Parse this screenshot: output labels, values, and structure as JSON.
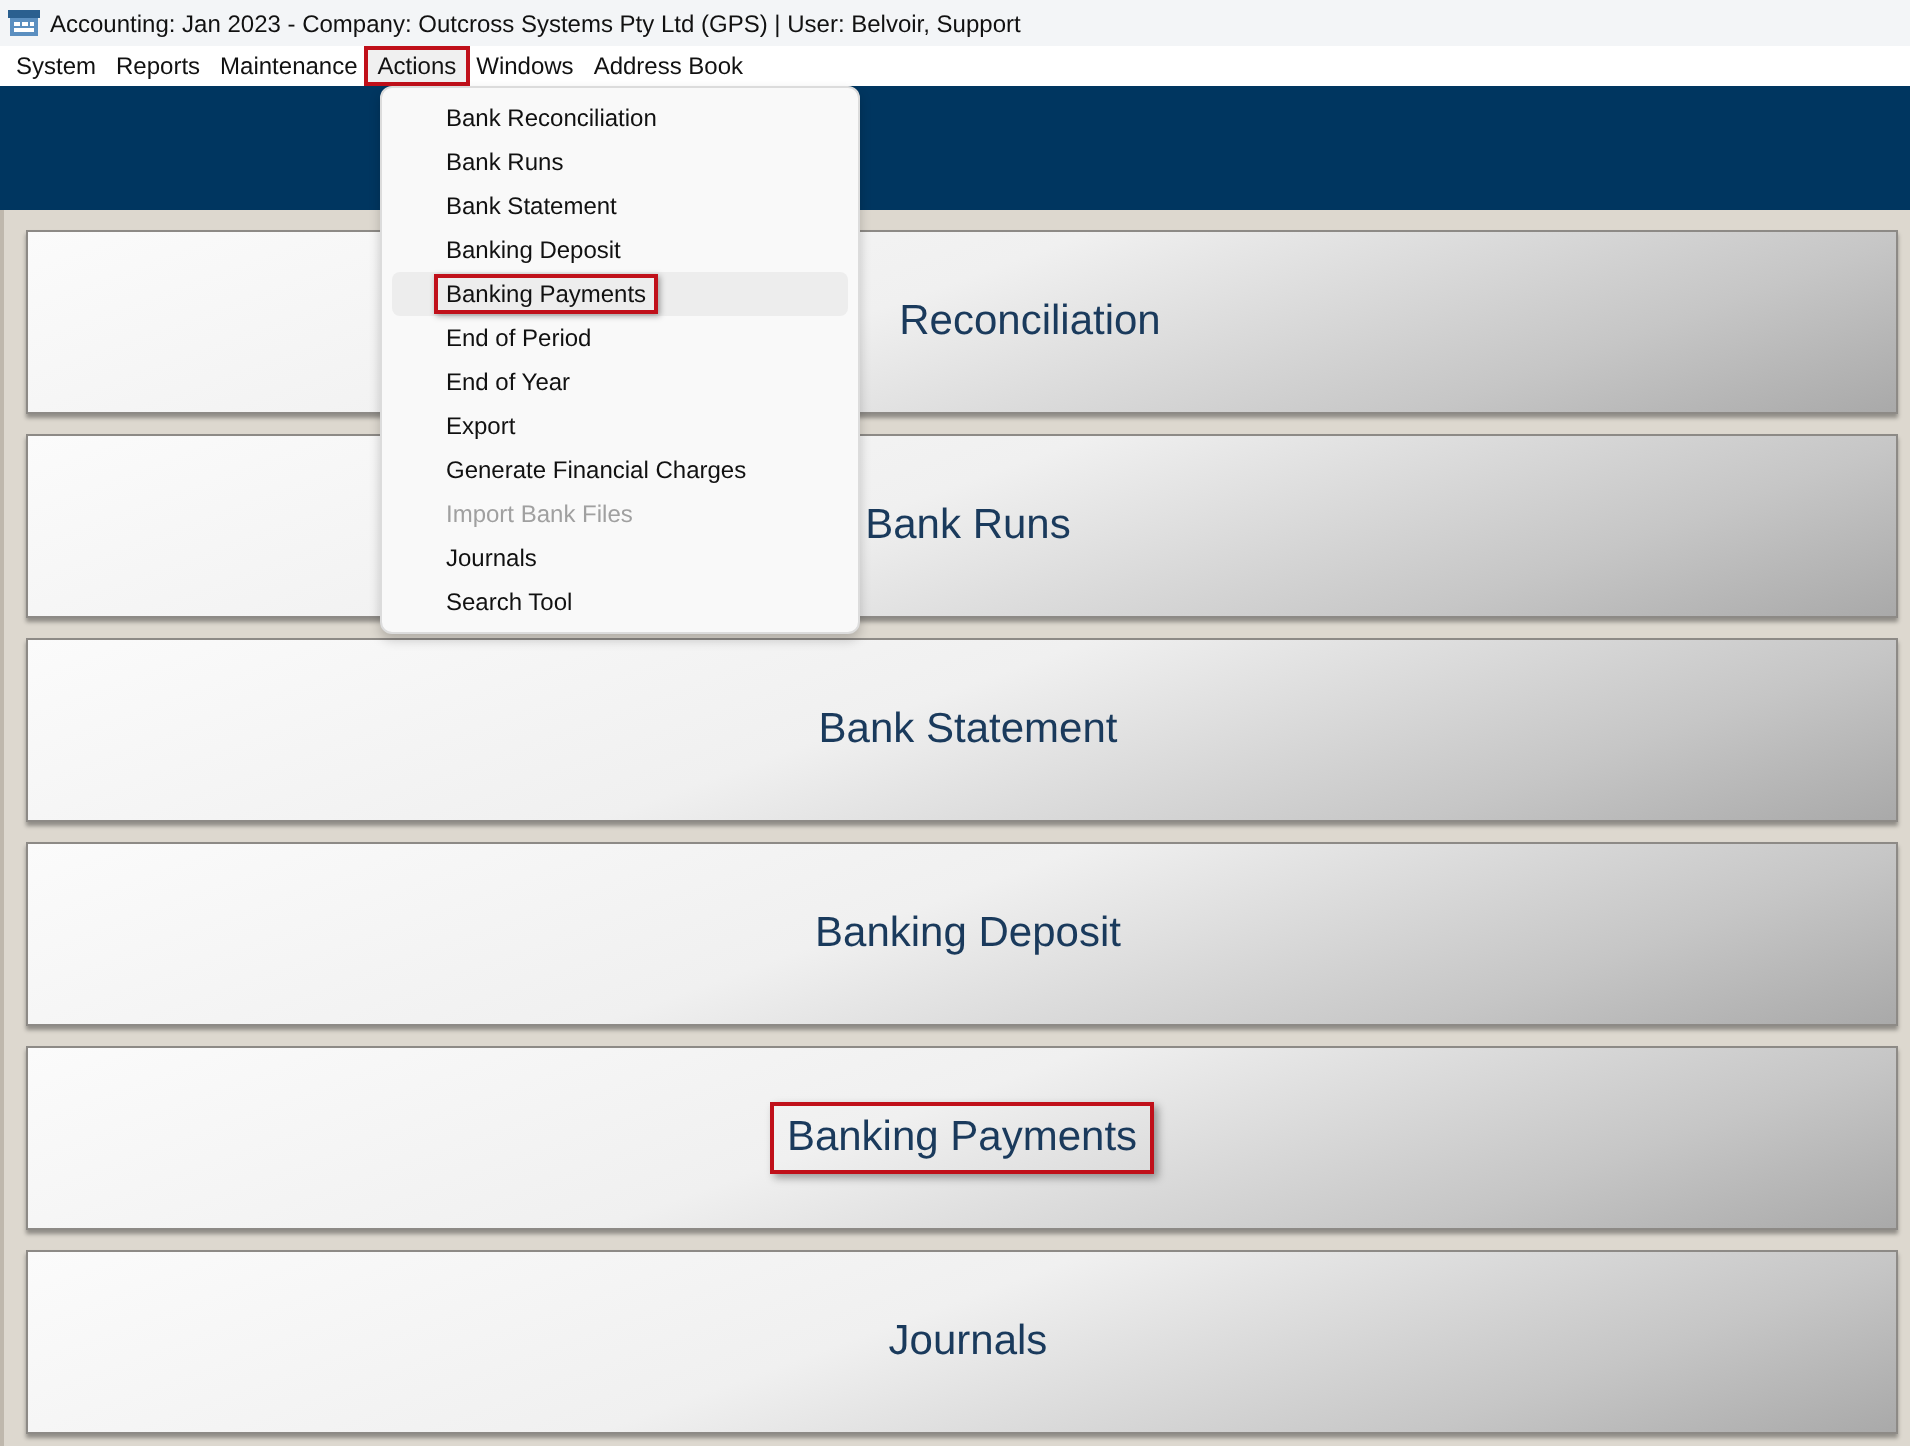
{
  "window": {
    "title": "Accounting: Jan 2023 - Company: Outcross Systems Pty Ltd (GPS) | User: Belvoir, Support"
  },
  "menu_bar": [
    {
      "label": "System",
      "selected": false,
      "highlighted": false
    },
    {
      "label": "Reports",
      "selected": false,
      "highlighted": false
    },
    {
      "label": "Maintenance",
      "selected": false,
      "highlighted": false
    },
    {
      "label": "Actions",
      "selected": true,
      "highlighted": true
    },
    {
      "label": "Windows",
      "selected": false,
      "highlighted": false
    },
    {
      "label": "Address Book",
      "selected": false,
      "highlighted": false
    }
  ],
  "dropdown": [
    {
      "label": "Bank Reconciliation",
      "disabled": false,
      "selected": false,
      "highlighted": false
    },
    {
      "label": "Bank Runs",
      "disabled": false,
      "selected": false,
      "highlighted": false
    },
    {
      "label": "Bank Statement",
      "disabled": false,
      "selected": false,
      "highlighted": false
    },
    {
      "label": "Banking Deposit",
      "disabled": false,
      "selected": false,
      "highlighted": false
    },
    {
      "label": "Banking Payments",
      "disabled": false,
      "selected": true,
      "highlighted": true
    },
    {
      "label": "End of Period",
      "disabled": false,
      "selected": false,
      "highlighted": false
    },
    {
      "label": "End of Year",
      "disabled": false,
      "selected": false,
      "highlighted": false
    },
    {
      "label": "Export",
      "disabled": false,
      "selected": false,
      "highlighted": false
    },
    {
      "label": "Generate Financial Charges",
      "disabled": false,
      "selected": false,
      "highlighted": false
    },
    {
      "label": "Import Bank Files",
      "disabled": true,
      "selected": false,
      "highlighted": false
    },
    {
      "label": "Journals",
      "disabled": false,
      "selected": false,
      "highlighted": false
    },
    {
      "label": "Search Tool",
      "disabled": false,
      "selected": false,
      "highlighted": false
    }
  ],
  "buttons": [
    {
      "label": "Reconciliation",
      "covered": true,
      "highlighted": false
    },
    {
      "label": "Bank Runs",
      "covered": false,
      "highlighted": false
    },
    {
      "label": "Bank Statement",
      "covered": false,
      "highlighted": false
    },
    {
      "label": "Banking Deposit",
      "covered": false,
      "highlighted": false
    },
    {
      "label": "Banking Payments",
      "covered": false,
      "highlighted": true
    },
    {
      "label": "Journals",
      "covered": false,
      "highlighted": false
    }
  ]
}
